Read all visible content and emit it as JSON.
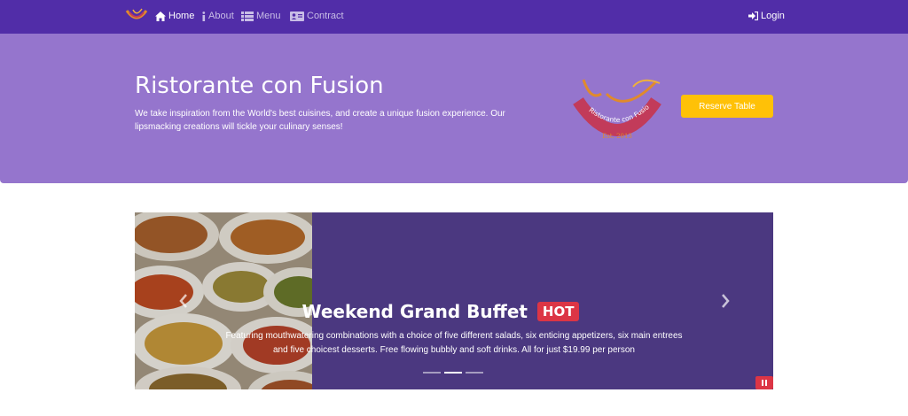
{
  "navbar": {
    "brand_icon": "logo-icon",
    "items": [
      {
        "label": "Home",
        "icon": "home-icon",
        "active": true
      },
      {
        "label": "About",
        "icon": "info-icon",
        "active": false
      },
      {
        "label": "Menu",
        "icon": "list-icon",
        "active": false
      },
      {
        "label": "Contract",
        "icon": "address-card-icon",
        "active": false
      }
    ],
    "login_label": "Login",
    "login_icon": "sign-in-icon",
    "background_color": "#512DA8"
  },
  "hero": {
    "title": "Ristorante con Fusion",
    "text": "We take inspiration from the World's best cuisines, and create a unique fusion experience. Our lipsmacking creations will tickle your culinary senses!",
    "logo": {
      "banner_text": "Ristorante con Fusion",
      "est_text": "Est. 2013"
    },
    "reserve_label": "Reserve Table",
    "background_color": "#9575CD",
    "button_color": "#FFC107"
  },
  "carousel": {
    "title": "Weekend Grand Buffet",
    "badge": "HOT",
    "text": "Featuring mouthwatering combinations with a choice of five different salads, six enticing appetizers, six main entrees and five choicest desserts. Free flowing bubbly and soft drinks. All for just $19.99 per person",
    "indicator_count": 3,
    "active_indicator": 1,
    "background_color": "#4B3880",
    "badge_color": "#dc3545"
  }
}
